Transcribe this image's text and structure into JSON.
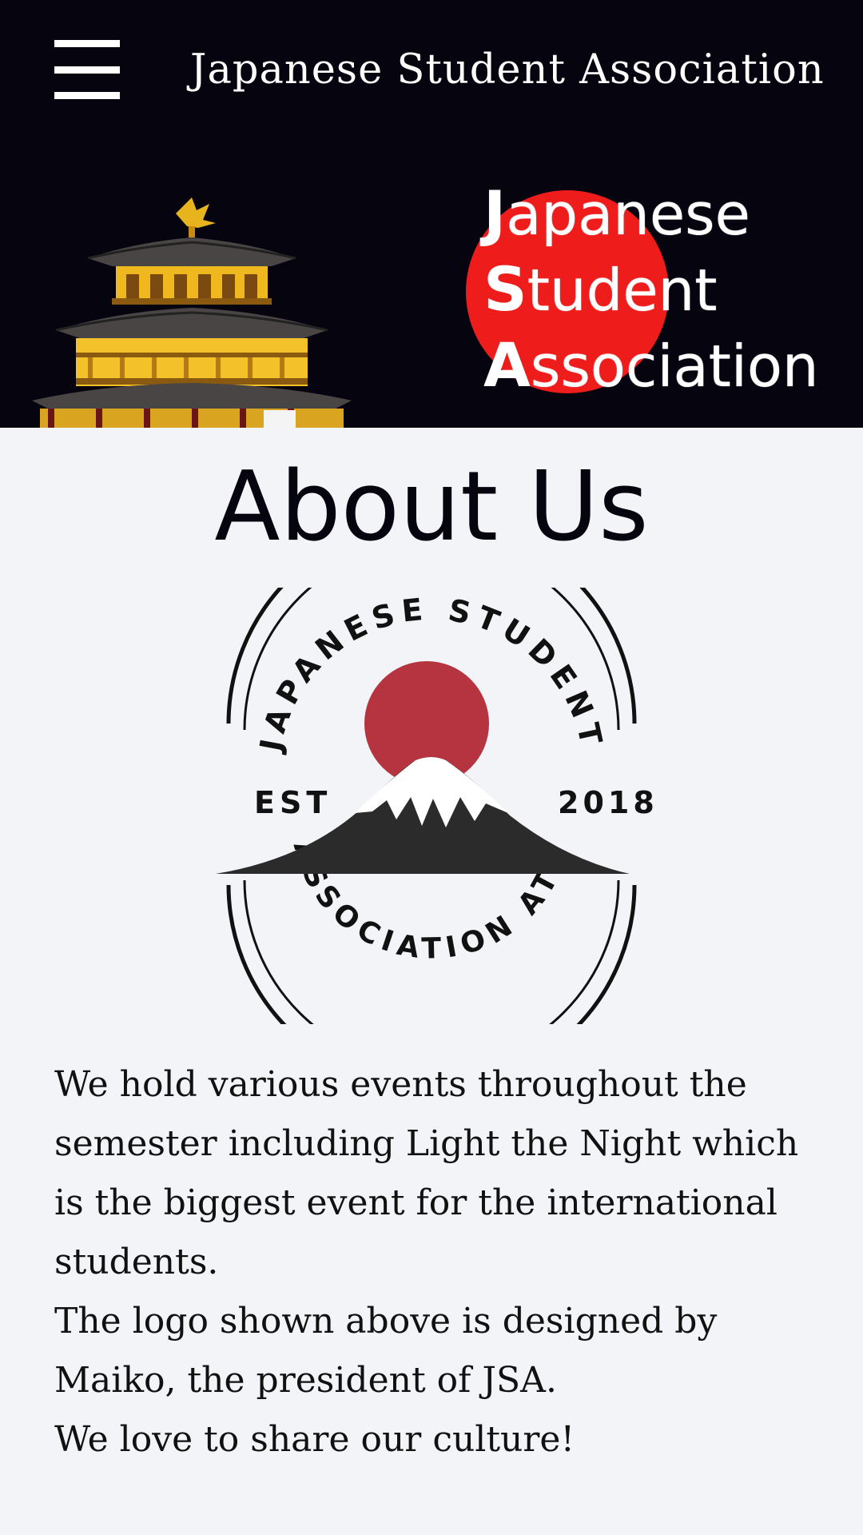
{
  "header": {
    "menu_icon": "hamburger-menu-icon",
    "title": "Japanese Student Association"
  },
  "hero": {
    "pagoda_image": "golden-pavilion-pagoda-illustration",
    "words": [
      {
        "cap": "J",
        "rest": "apanese"
      },
      {
        "cap": "S",
        "rest": "tudent"
      },
      {
        "cap": "A",
        "rest": "ssociation"
      }
    ],
    "sun_color": "#ef1c1c"
  },
  "about": {
    "heading": "About Us",
    "logo": {
      "top_arc_text": "JAPANESE STUDENT",
      "bottom_arc_text": "ASSOCIATION ATU",
      "est_label": "EST",
      "est_year": "2018",
      "sun_color": "#b5343f",
      "mountain_color": "#2b2b2b"
    },
    "paragraphs": [
      "We hold various events throughout the semester including Light  the Night which is the biggest event for the international students.",
      "The logo shown above is designed by Maiko,  the president of JSA.",
      "We love to share our culture!"
    ]
  },
  "colors": {
    "header_bg": "#05040f",
    "page_bg": "#f3f4f7",
    "accent_red": "#ef1c1c"
  }
}
